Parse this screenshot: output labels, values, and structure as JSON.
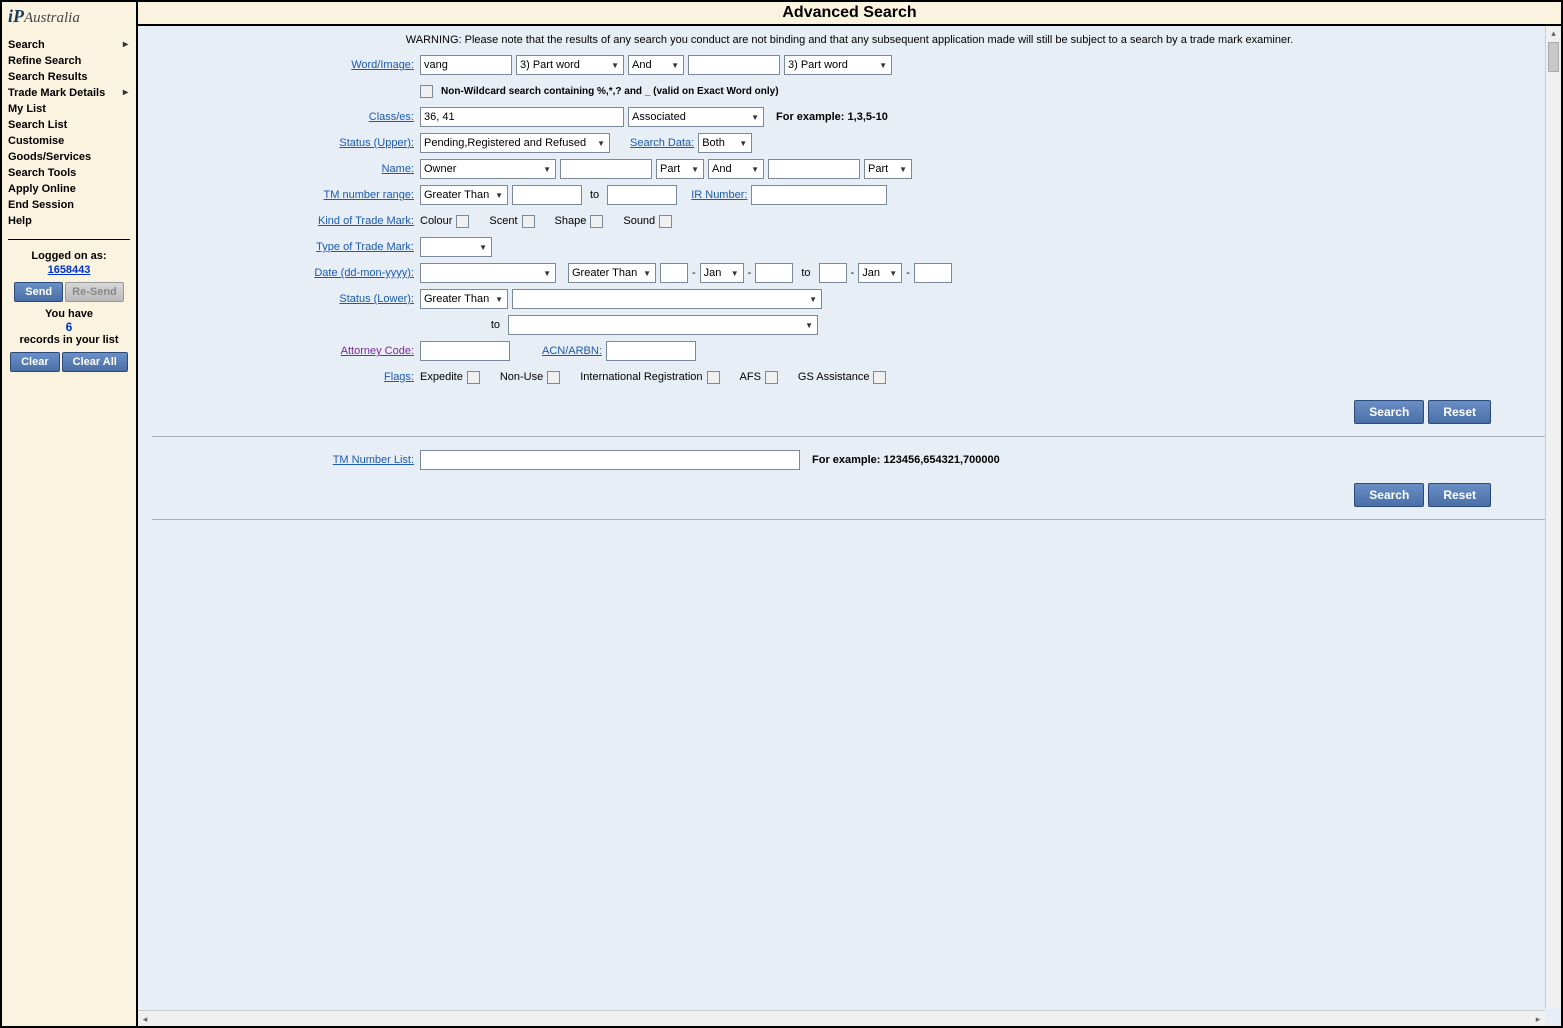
{
  "header": {
    "title": "Advanced Search"
  },
  "logo": {
    "ip": "iP",
    "au": "Australia"
  },
  "nav": [
    {
      "label": "Search",
      "sub": true
    },
    {
      "label": "Refine Search",
      "sub": false
    },
    {
      "label": "Search Results",
      "sub": false
    },
    {
      "label": "Trade Mark Details",
      "sub": true
    },
    {
      "label": "My List",
      "sub": false
    },
    {
      "label": "Search List",
      "sub": false
    },
    {
      "label": "Customise",
      "sub": false
    },
    {
      "label": "Goods/Services",
      "sub": false
    },
    {
      "label": "Search Tools",
      "sub": false
    },
    {
      "label": "Apply Online",
      "sub": false
    },
    {
      "label": "End Session",
      "sub": false
    },
    {
      "label": "Help",
      "sub": false
    }
  ],
  "session": {
    "logged_on_label": "Logged on as:",
    "id": "1658443",
    "send": "Send",
    "resend": "Re-Send",
    "you_have": "You have",
    "count": "6",
    "records": "records in your list",
    "clear": "Clear",
    "clear_all": "Clear All"
  },
  "warning": "WARNING: Please note that the results of any search you conduct are not binding and that any subsequent application made will still be subject to a search by a trade mark examiner.",
  "labels": {
    "word_image": "Word/Image:",
    "class_es": "Class/es:",
    "status_upper": "Status (Upper):",
    "search_data": "Search Data:",
    "name": "Name:",
    "tm_number_range": "TM number range:",
    "ir_number": "IR Number:",
    "kind_tm": "Kind of Trade Mark:",
    "type_tm": "Type of Trade Mark:",
    "date": "Date (dd-mon-yyyy):",
    "status_lower": "Status (Lower):",
    "attorney_code": "Attorney Code:",
    "acn_arbn": "ACN/ARBN:",
    "flags": "Flags:",
    "tm_number_list": "TM Number List:",
    "to": "to",
    "dash": "-"
  },
  "values": {
    "word1": "vang",
    "word_match1": "3) Part word",
    "word_op": "And",
    "word2": "",
    "word_match2": "3) Part word",
    "wildcard_hint": "Non-Wildcard search containing %,*,? and _ (valid on Exact Word only)",
    "classes": "36, 41",
    "class_mode": "Associated",
    "class_hint": "For example: 1,3,5-10",
    "status_upper": "Pending,Registered and Refused",
    "search_data": "Both",
    "name_type": "Owner",
    "name_val": "",
    "name_match1": "Part",
    "name_op": "And",
    "name_val2": "",
    "name_match2": "Part",
    "tmrange_op": "Greater Than",
    "tmrange_from": "",
    "tmrange_to": "",
    "ir_number": "",
    "kind_colour": "Colour",
    "kind_scent": "Scent",
    "kind_shape": "Shape",
    "kind_sound": "Sound",
    "type_tm": "",
    "date_type": "",
    "date_op": "Greater Than",
    "date_day1": "",
    "date_mon1": "Jan",
    "date_year1": "",
    "date_day2": "",
    "date_mon2": "Jan",
    "date_year2": "",
    "status_lower_op": "Greater Than",
    "status_lower_from": "",
    "status_lower_to": "",
    "attorney_code": "",
    "acn_arbn": "",
    "flag_expedite": "Expedite",
    "flag_nonuse": "Non-Use",
    "flag_intl": "International Registration",
    "flag_afs": "AFS",
    "flag_gs": "GS Assistance",
    "tm_number_list": "",
    "tm_list_hint": "For example: 123456,654321,700000"
  },
  "buttons": {
    "search": "Search",
    "reset": "Reset"
  }
}
